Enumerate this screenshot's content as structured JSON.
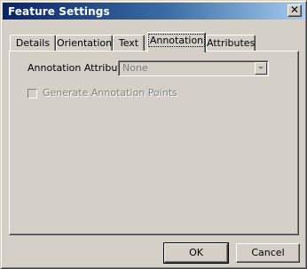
{
  "window": {
    "title": "Feature Settings",
    "close_glyph": "✕"
  },
  "tabs": [
    {
      "label": "Details",
      "active": false
    },
    {
      "label": "Orientation",
      "active": false
    },
    {
      "label": "Text",
      "active": false
    },
    {
      "label": "Annotation",
      "active": true
    },
    {
      "label": "Attributes",
      "active": false
    }
  ],
  "annotation_panel": {
    "attribute_label": "Annotation Attribute:",
    "attribute_value": "None",
    "attribute_enabled": false,
    "generate_points_label": "Generate Annotation Points",
    "generate_points_checked": false,
    "generate_points_enabled": false
  },
  "buttons": {
    "ok": "OK",
    "cancel": "Cancel"
  },
  "colors": {
    "face": "#d4d0c8",
    "title_start": "#0a246a",
    "title_end": "#a6caf0",
    "disabled_text": "#808080"
  }
}
